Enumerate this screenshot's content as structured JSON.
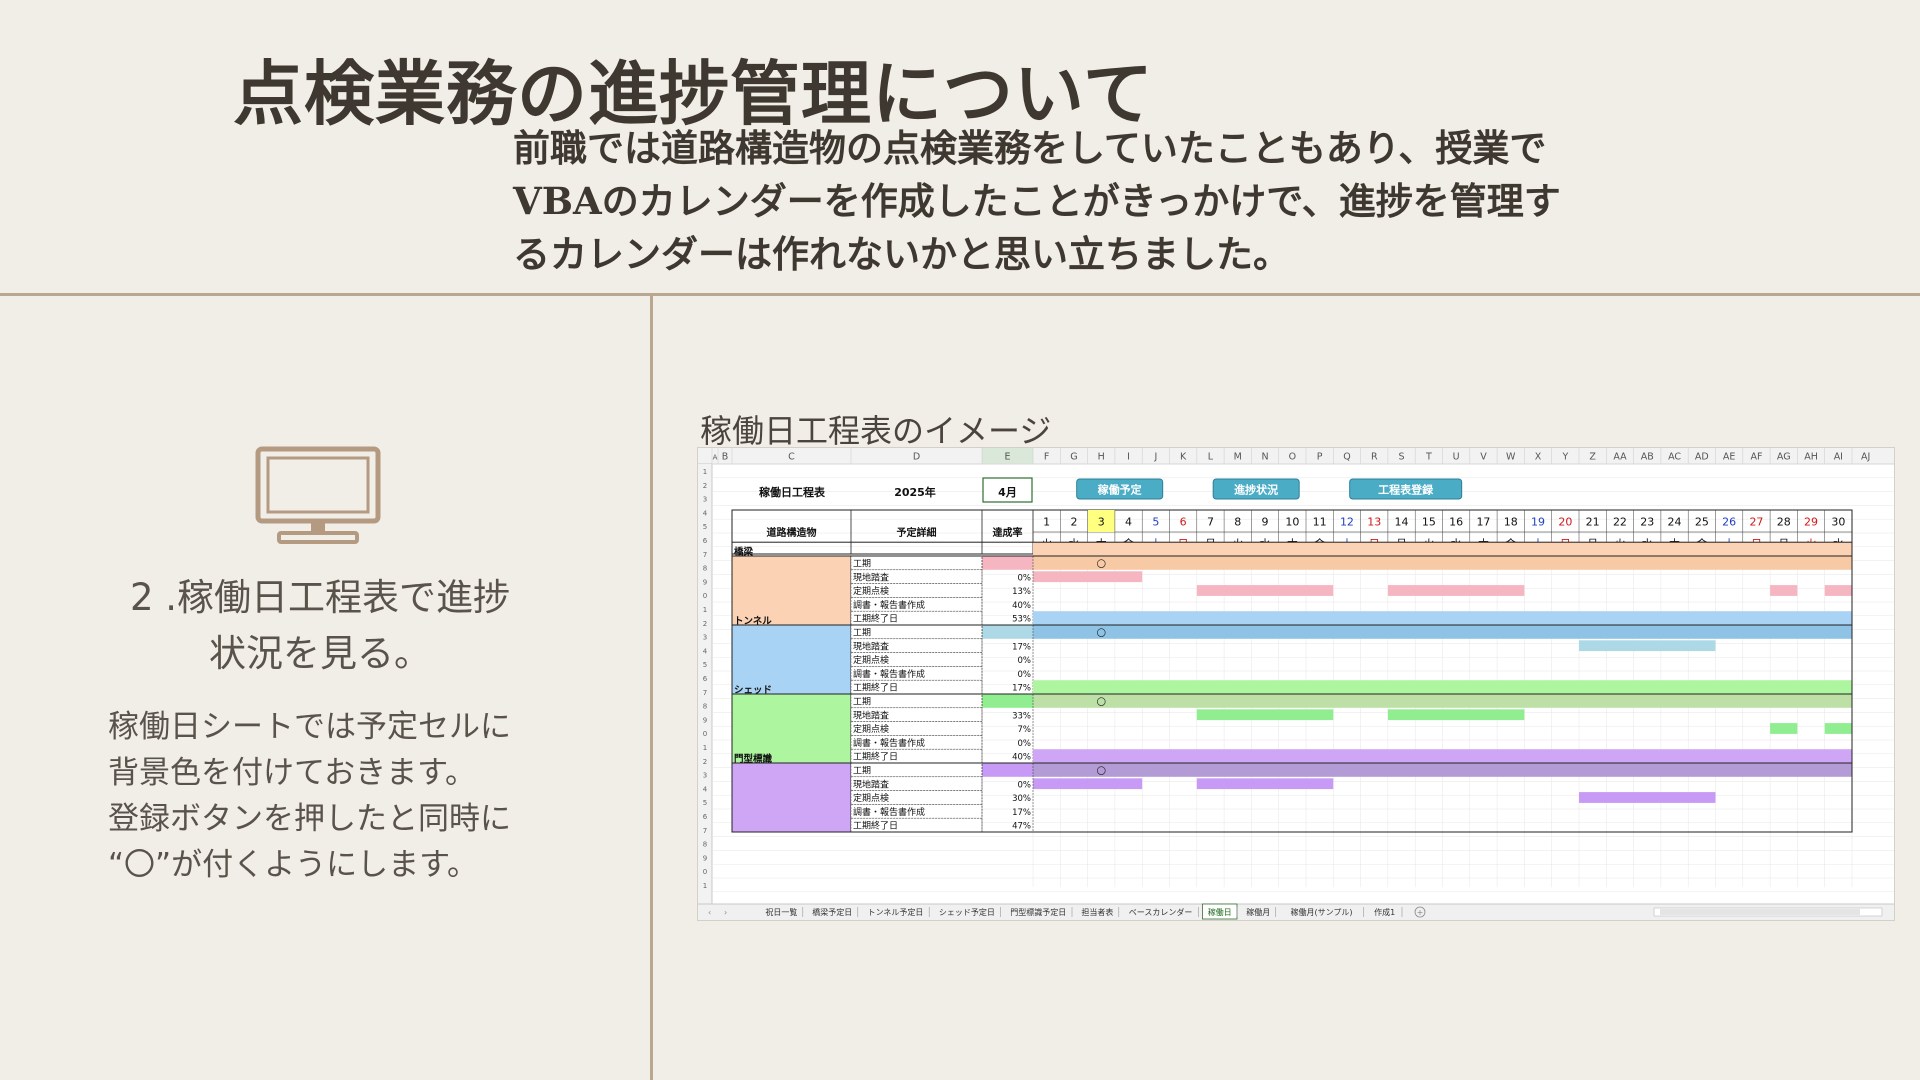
{
  "title": "点検業務の進捗管理について",
  "intro_lines": [
    "前職では道路構造物の点検業務をしていたこともあり、授業で",
    "VBAのカレンダーを作成したことがきっかけで、進捗を管理す",
    "るカレンダーは作れないかと思い立ちました。"
  ],
  "left": {
    "step_title_lines": [
      "2 .稼働日工程表で進捗",
      "状況を見る。"
    ],
    "desc_lines": [
      "稼働日シートでは予定セルに",
      "背景色を付けておきます。",
      "登録ボタンを押したと同時に",
      "“〇”が付くようにします。"
    ]
  },
  "image_caption": "稼働日工程表のイメージ",
  "sheet": {
    "top_label": "稼働日工程表",
    "year": "2025年",
    "month": "4月",
    "buttons": [
      "稼働予定",
      "進捗状況",
      "工程表登録"
    ],
    "header_structure": "道路構造物",
    "header_detail": "予定詳細",
    "header_rate": "達成率",
    "col_letters": [
      "A",
      "B",
      "C",
      "D",
      "E",
      "F",
      "G",
      "H",
      "I",
      "J",
      "K",
      "L",
      "M",
      "N",
      "O",
      "P",
      "Q",
      "R",
      "S",
      "T",
      "U",
      "V",
      "W",
      "X",
      "Y",
      "Z",
      "AA",
      "AB",
      "AC",
      "AD",
      "AE",
      "AF",
      "AG",
      "AH",
      "AI",
      "AJ"
    ],
    "days": [
      "1",
      "2",
      "3",
      "4",
      "5",
      "6",
      "7",
      "8",
      "9",
      "10",
      "11",
      "12",
      "13",
      "14",
      "15",
      "16",
      "17",
      "18",
      "19",
      "20",
      "21",
      "22",
      "23",
      "24",
      "25",
      "26",
      "27",
      "28",
      "29",
      "30"
    ],
    "weekdays": [
      "火",
      "水",
      "木",
      "金",
      "土",
      "日",
      "月",
      "火",
      "水",
      "木",
      "金",
      "土",
      "日",
      "月",
      "火",
      "水",
      "木",
      "金",
      "土",
      "日",
      "月",
      "火",
      "水",
      "木",
      "金",
      "土",
      "日",
      "月",
      "火",
      "水"
    ],
    "day_colors": {
      "blue": "#1f3fbf",
      "red": "#d01818",
      "today_bg": "#ffff80"
    },
    "groups": [
      {
        "name": "橋梁",
        "color": "#fbd2b4",
        "bar": "#f8c9a5",
        "task": "#f5b6c2",
        "rows": [
          {
            "label": "工期",
            "rate": ""
          },
          {
            "label": "現地踏査",
            "rate": "0%"
          },
          {
            "label": "定期点検",
            "rate": "13%"
          },
          {
            "label": "調書・報告書作成",
            "rate": "40%"
          },
          {
            "label": "工期終了日",
            "rate": "53%"
          }
        ]
      },
      {
        "name": "トンネル",
        "color": "#a9d3f5",
        "bar": "#8fc3e6",
        "task": "#add8e6",
        "rows": [
          {
            "label": "工期",
            "rate": ""
          },
          {
            "label": "現地踏査",
            "rate": "17%"
          },
          {
            "label": "定期点検",
            "rate": "0%"
          },
          {
            "label": "調書・報告書作成",
            "rate": "0%"
          },
          {
            "label": "工期終了日",
            "rate": "17%"
          }
        ]
      },
      {
        "name": "シェッド",
        "color": "#aef5a0",
        "bar": "#bde0a6",
        "task": "#90ee90",
        "rows": [
          {
            "label": "工期",
            "rate": ""
          },
          {
            "label": "現地踏査",
            "rate": "33%"
          },
          {
            "label": "定期点検",
            "rate": "7%"
          },
          {
            "label": "調書・報告書作成",
            "rate": "0%"
          },
          {
            "label": "工期終了日",
            "rate": "40%"
          }
        ]
      },
      {
        "name": "門型標識",
        "color": "#cfa6f5",
        "bar": "#b39bd6",
        "task": "#c79af5",
        "rows": [
          {
            "label": "工期",
            "rate": ""
          },
          {
            "label": "現地踏査",
            "rate": "0%"
          },
          {
            "label": "定期点検",
            "rate": "30%"
          },
          {
            "label": "調書・報告書作成",
            "rate": "17%"
          },
          {
            "label": "工期終了日",
            "rate": "47%"
          }
        ]
      }
    ],
    "circle_mark": "○",
    "sheet_tabs": [
      "祝日一覧",
      "橋梁予定日",
      "トンネル予定日",
      "シェッド予定日",
      "門型標識予定日",
      "担当者表",
      "ベースカレンダー",
      "稼働日",
      "稼働月",
      "稼働月(サンプル)",
      "作成1"
    ],
    "active_tab": "稼働日"
  }
}
